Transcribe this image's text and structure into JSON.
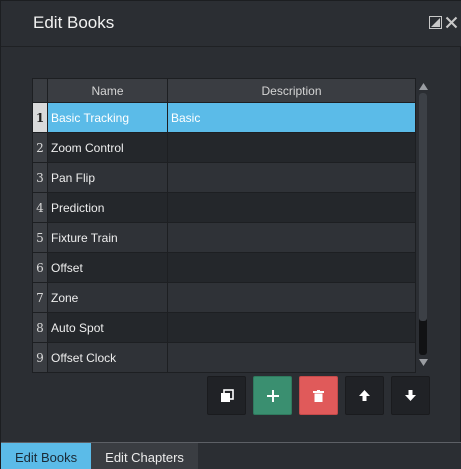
{
  "window": {
    "title": "Edit Books"
  },
  "grid": {
    "columns": [
      "Name",
      "Description"
    ],
    "rows": [
      {
        "index": "1",
        "name": "Basic Tracking",
        "description": "Basic",
        "selected": true
      },
      {
        "index": "2",
        "name": "Zoom Control",
        "description": ""
      },
      {
        "index": "3",
        "name": "Pan Flip",
        "description": ""
      },
      {
        "index": "4",
        "name": "Prediction",
        "description": ""
      },
      {
        "index": "5",
        "name": "Fixture Train",
        "description": ""
      },
      {
        "index": "6",
        "name": "Offset",
        "description": ""
      },
      {
        "index": "7",
        "name": "Zone",
        "description": ""
      },
      {
        "index": "8",
        "name": "Auto Spot",
        "description": ""
      },
      {
        "index": "9",
        "name": "Offset Clock",
        "description": ""
      }
    ]
  },
  "toolbar": {
    "icons": [
      "copy-icon",
      "plus-icon",
      "trash-icon",
      "arrow-up-icon",
      "arrow-down-icon"
    ],
    "colors": {
      "add": "#3a8f70",
      "delete": "#e05a5a"
    }
  },
  "tabs": [
    {
      "label": "Edit Books",
      "active": true
    },
    {
      "label": "Edit Chapters",
      "active": false
    }
  ],
  "colors": {
    "accent": "#5bbbe8",
    "background": "#2b2e33"
  }
}
